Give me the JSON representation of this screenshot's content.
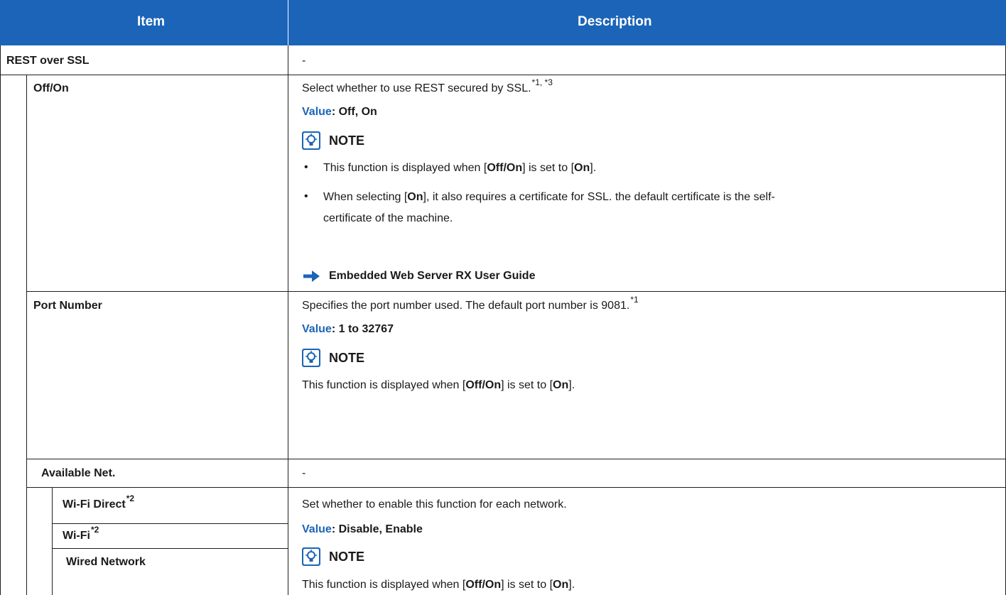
{
  "header": {
    "item": "Item",
    "description": "Description"
  },
  "rows": {
    "rest_over_ssl": {
      "item": "REST over SSL",
      "description": "-"
    },
    "off_on": {
      "item": "Off/On",
      "desc": "Select whether to use REST secured by SSL.",
      "sup": "*1, *3",
      "value_label": "Value",
      "value_sep": ":",
      "value_text": "Off, On",
      "note_label": "NOTE",
      "note1": {
        "a": "This function is displayed when [",
        "b": "Off/On",
        "c": "] is set to [",
        "d": "On",
        "e": "]."
      },
      "note2": {
        "a": "When selecting [",
        "b": "On",
        "c": "], it also requires a certificate for SSL. the default certificate is the self-",
        "line2": "certificate of the machine."
      },
      "reference": "Embedded Web Server RX User Guide"
    },
    "port_number": {
      "item": "Port Number",
      "desc": "Specifies the port number used. The default port number is 9081.",
      "sup": "*1",
      "value_label": "Value",
      "value_sep": ":",
      "value_text": "1 to 32767",
      "note_label": "NOTE",
      "note": {
        "a": "This function is displayed when [",
        "b": "Off/On",
        "c": "] is set to [",
        "d": "On",
        "e": "]."
      }
    },
    "available_net": {
      "item": "Available Net.",
      "description": "-"
    },
    "wifi_direct": {
      "item": "Wi-Fi Direct",
      "sup": "*2"
    },
    "wifi": {
      "item": "Wi-Fi",
      "sup": "*2"
    },
    "wired": {
      "item": "Wired Network"
    },
    "networks_desc": {
      "desc": "Set whether to enable this function for each network.",
      "value_label": "Value",
      "value_sep": ":",
      "value_text": "Disable, Enable",
      "note_label": "NOTE",
      "note": {
        "a": "This function is displayed when [",
        "b": "Off/On",
        "c": "] is set to [",
        "d": "On",
        "e": "]."
      }
    }
  },
  "symbols": {
    "bullet": "•"
  },
  "icons": {
    "note": "note-lightbulb-icon",
    "reference": "right-arrow-icon"
  },
  "colors": {
    "header_bg": "#1b64b8",
    "value_label": "#1b64b8",
    "rule": "#1f1f1f"
  }
}
